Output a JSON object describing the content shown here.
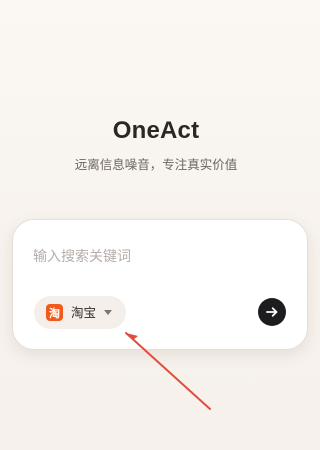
{
  "app": {
    "title": "OneAct",
    "subtitle": "远离信息噪音，专注真实价值"
  },
  "search": {
    "placeholder": "输入搜索关键词",
    "value": ""
  },
  "platform": {
    "selected": "淘宝",
    "icon_text": "淘",
    "icon": "taobao-icon",
    "accent_color": "#f05a1b"
  },
  "submit": {
    "icon": "arrow-right-icon",
    "background": "#1d1d1f"
  },
  "annotation": {
    "color": "#e14d3c"
  }
}
